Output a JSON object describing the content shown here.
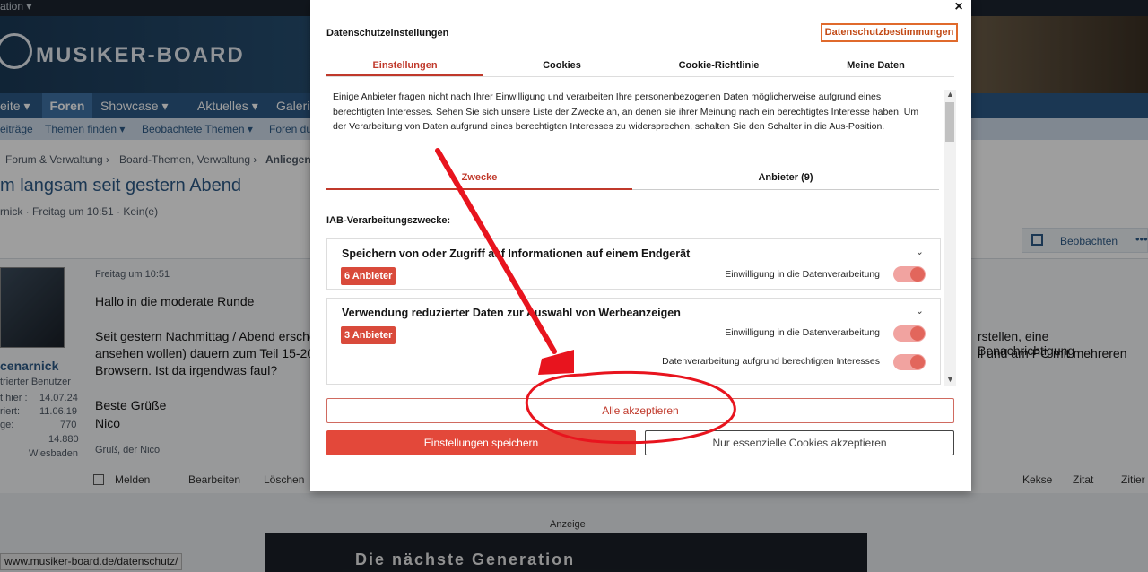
{
  "topbar": {
    "text": "ation ▾"
  },
  "site": {
    "logo": "MUSIKER-BOARD"
  },
  "nav": {
    "items": [
      "eite ▾",
      "Foren",
      "Showcase ▾",
      "Aktuelles ▾",
      "Galeri"
    ],
    "active": "Foren"
  },
  "subnav": {
    "items": [
      "eiträge",
      "Themen finden ▾",
      "Beobachtete Themen ▾",
      "Foren du"
    ]
  },
  "breadcrumb": {
    "items": [
      "Forum & Verwaltung ›",
      "Board-Themen, Verwaltung ›",
      "Anliegen"
    ]
  },
  "thread": {
    "title": "m langsam seit gestern Abend",
    "meta": "rnick · Freitag um 10:51 · Kein(e)",
    "watch_label": "Beobachten"
  },
  "post": {
    "date": "Freitag um 10:51",
    "username": "cenarnick",
    "user_title": "trierter Benutzer",
    "stats": [
      {
        "label": "t hier :",
        "value": "14.07.24"
      },
      {
        "label": "riert:",
        "value": "11.06.19"
      },
      {
        "label": "ge:",
        "value": "770"
      },
      {
        "label": "",
        "value": "14.880"
      },
      {
        "label": "",
        "value": "Wiesbaden"
      }
    ],
    "greeting": "Hallo in die moderate Runde",
    "body_line1": "Seit gestern Nachmittag / Abend ersche",
    "body_line2": "ansehen wollen) dauern zum Teil 15-20",
    "body_line3": "Browsern. Ist da irgendwas faul?",
    "body_right1": "rstellen, eine Benachrichtigung",
    "body_right2": "il und am PC mit mehreren",
    "closing": "Beste Grüße",
    "name": "Nico",
    "signature": "Gruß, der Nico",
    "actions": [
      "Melden",
      "Bearbeiten",
      "Löschen"
    ],
    "actions_right": [
      "Kekse",
      "Zitat",
      "Zitier"
    ]
  },
  "ad": {
    "label": "Anzeige",
    "text": "Die nächste Generation"
  },
  "statusbar": {
    "url": "www.musiker-board.de/datenschutz/"
  },
  "modal": {
    "close": "×",
    "title": "Datenschutzeinstellungen",
    "policy_link": "Datenschutzbestimmungen",
    "tabs": [
      "Einstellungen",
      "Cookies",
      "Cookie-Richtlinie",
      "Meine Daten"
    ],
    "intro": "Einige Anbieter fragen nicht nach Ihrer Einwilligung und verarbeiten Ihre personenbezogenen Daten möglicherweise aufgrund eines berechtigten Interesses. Sehen Sie sich unsere Liste der Zwecke an, an denen sie ihrer Meinung nach ein berechtigtes Interesse haben. Um der Verarbeitung von Daten aufgrund eines berechtigten Interesses zu widersprechen, schalten Sie den Schalter in die Aus-Position.",
    "subtabs": [
      "Zwecke",
      "Anbieter (9)"
    ],
    "iab_heading": "IAB-Verarbeitungszwecke:",
    "purposes": [
      {
        "title": "Speichern von oder Zugriff auf Informationen auf einem Endgerät",
        "badge": "6 Anbieter",
        "toggles": [
          {
            "label": "Einwilligung in die Datenverarbeitung",
            "on": true
          }
        ]
      },
      {
        "title": "Verwendung reduzierter Daten zur Auswahl von Werbeanzeigen",
        "badge": "3 Anbieter",
        "toggles": [
          {
            "label": "Einwilligung in die Datenverarbeitung",
            "on": true
          },
          {
            "label": "Datenverarbeitung aufgrund berechtigten Interesses",
            "on": true
          }
        ]
      }
    ],
    "accept_all": "Alle akzeptieren",
    "save": "Einstellungen speichern",
    "essential_only": "Nur essenzielle Cookies akzeptieren"
  },
  "colors": {
    "accent": "#c0392b",
    "button": "#e3483a",
    "annotation": "#e8141e",
    "nav": "#2d5a86"
  }
}
